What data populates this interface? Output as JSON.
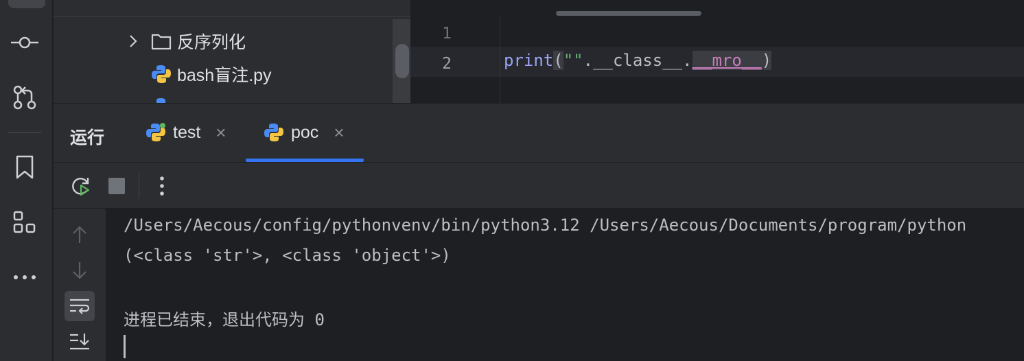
{
  "tree": {
    "items": [
      {
        "label": "反序列化",
        "icon": "folder-icon"
      },
      {
        "label": "bash盲注.py",
        "icon": "python-file-icon"
      },
      {
        "label": "",
        "icon": "python-file-icon"
      }
    ]
  },
  "editor": {
    "line_numbers": [
      "1",
      "2"
    ],
    "code_line_2": {
      "fn": "print",
      "open": "(",
      "str": "\"\"",
      "dot1": ".",
      "attr": "__class__",
      "dot2": ".",
      "mro": "__mro__",
      "close": ")"
    }
  },
  "run": {
    "title": "运行",
    "tabs": [
      {
        "label": "test",
        "close": "×"
      },
      {
        "label": "poc",
        "close": "×"
      }
    ],
    "console": [
      "/Users/Aecous/config/pythonvenv/bin/python3.12 /Users/Aecous/Documents/program/python",
      "(<class 'str'>, <class 'object'>)",
      "",
      "进程已结束，退出代码为 0"
    ]
  },
  "colors": {
    "accent": "#3574f0",
    "rerun_green": "#5fb85f",
    "bg_dark": "#1e1f22",
    "panel": "#2b2d30"
  }
}
